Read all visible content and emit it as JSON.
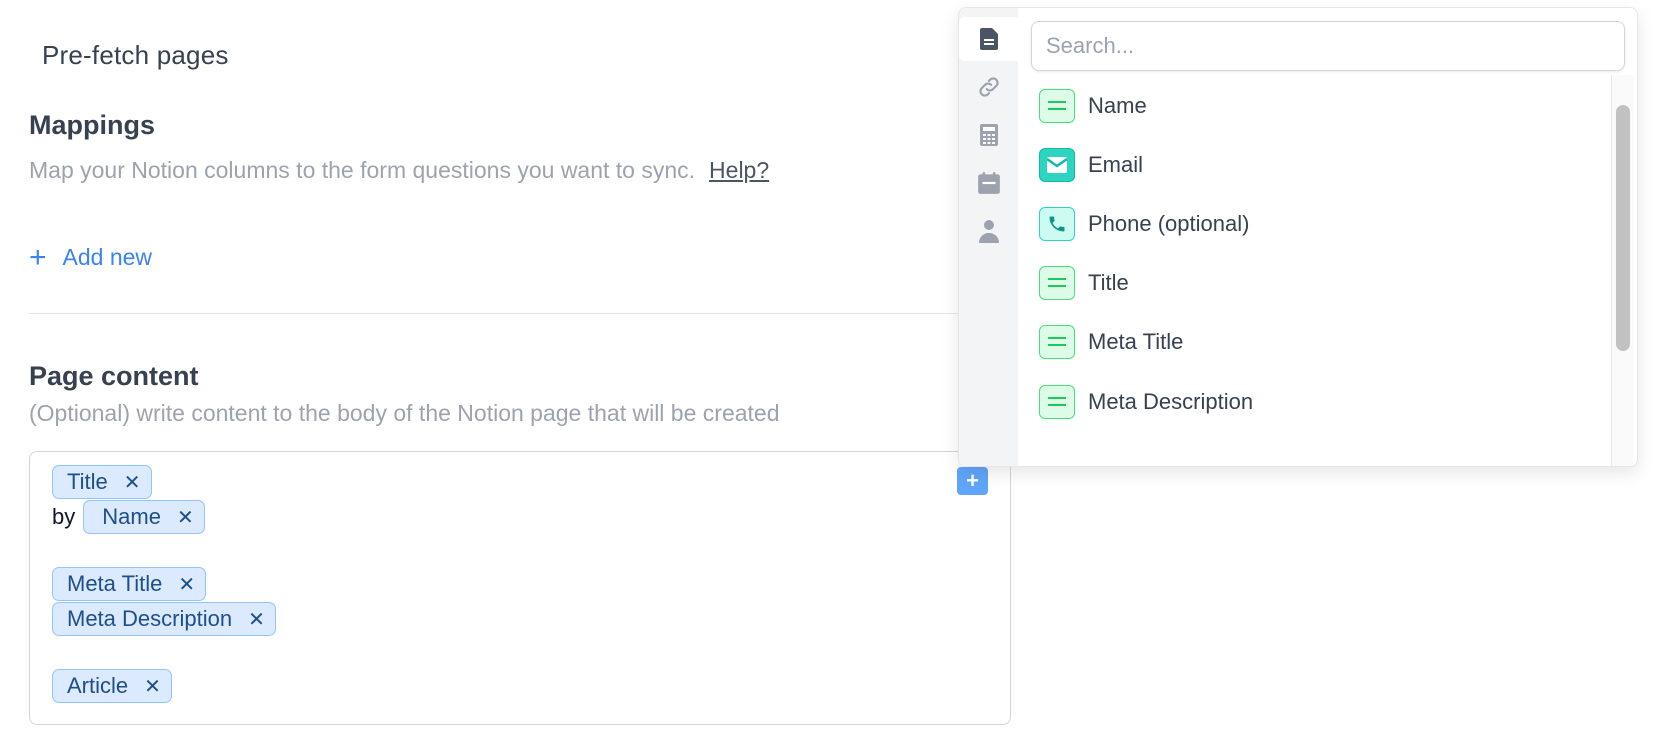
{
  "header": {
    "prefetch_label": "Pre-fetch pages"
  },
  "mappings": {
    "title": "Mappings",
    "description": "Map your Notion columns to the form questions you want to sync.",
    "help_label": "Help?",
    "add_new_label": "Add new",
    "add_new_icon": "+"
  },
  "page_content": {
    "title": "Page content",
    "description": "(Optional) write content to the body of the Notion page that will be created",
    "by_text": "by",
    "chips": {
      "title": "Title",
      "name": "Name",
      "meta_title": "Meta Title",
      "meta_description": "Meta Description",
      "article": "Article"
    },
    "remove_icon": "✕",
    "insert_button_label": "+"
  },
  "dropdown": {
    "search_placeholder": "Search...",
    "sidebar_icons": [
      "document-icon",
      "link-icon",
      "calculator-icon",
      "calendar-icon",
      "person-icon"
    ],
    "items": [
      {
        "label": "Name",
        "icon": "text-lines-icon"
      },
      {
        "label": "Email",
        "icon": "envelope-icon"
      },
      {
        "label": "Phone (optional)",
        "icon": "phone-icon"
      },
      {
        "label": "Title",
        "icon": "text-lines-icon"
      },
      {
        "label": "Meta Title",
        "icon": "text-lines-icon"
      },
      {
        "label": "Meta Description",
        "icon": "text-lines-icon"
      }
    ]
  },
  "colors": {
    "accent": "#3b82f6",
    "chip_bg": "#dbeafe",
    "chip_border": "#93c5fd",
    "chip_text": "#1e4f8a",
    "text_type_green": "#4ade80",
    "contact_type_teal": "#2dd4bf"
  }
}
